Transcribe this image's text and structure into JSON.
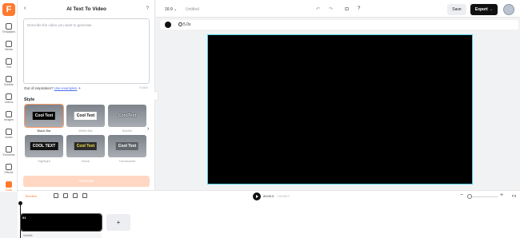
{
  "rail": {
    "logo": "F",
    "items": [
      {
        "label": "Templates",
        "icon": "templates-icon"
      },
      {
        "label": "Media",
        "icon": "media-icon"
      },
      {
        "label": "Text",
        "icon": "text-icon"
      },
      {
        "label": "Subtitle",
        "icon": "subtitle-icon"
      },
      {
        "label": "Videos",
        "icon": "videos-icon"
      },
      {
        "label": "Images",
        "icon": "images-icon"
      },
      {
        "label": "Audio",
        "icon": "audio-icon"
      },
      {
        "label": "Elements",
        "icon": "elements-icon"
      },
      {
        "label": "Effects",
        "icon": "effects-icon"
      },
      {
        "label": "Tools",
        "icon": "tools-icon",
        "active": true
      }
    ]
  },
  "panel": {
    "title": "AI Text To Video",
    "back": "‹",
    "prompt_placeholder": "Describe the video you want to generate",
    "counter": "0/1500",
    "inspiration_text": "Out of inspiration? ",
    "inspiration_link": "Use examples",
    "style_heading": "Style",
    "styles": [
      {
        "name": "Black Bar",
        "chip": "Cool Text",
        "selected": true
      },
      {
        "name": "White Bar",
        "chip": "Cool Text"
      },
      {
        "name": "Border",
        "chip": "Cool Text"
      },
      {
        "name": "Highlight",
        "chip": "COOL TEXT"
      },
      {
        "name": "Block",
        "chip": "Cool Text"
      },
      {
        "name": "Translucent",
        "chip": "Cool Text"
      }
    ],
    "generate_label": "Generate"
  },
  "topbar": {
    "ratio": "16:9 ⌄",
    "doc_title": "Untitled",
    "save_label": "Save",
    "export_label": "Export →"
  },
  "canvas": {
    "duration": "5.0s"
  },
  "timeline": {
    "tab_label": "Timeline",
    "current_time": "00:00.0",
    "total_time": "/ 00:05.0",
    "fit_label": "Fit",
    "clip_number": "01",
    "add_label": "+",
    "subtitle_row": "Subtitle"
  },
  "colors": {
    "accent": "#ff7a2f",
    "canvas_outline": "#4fd0e6"
  }
}
